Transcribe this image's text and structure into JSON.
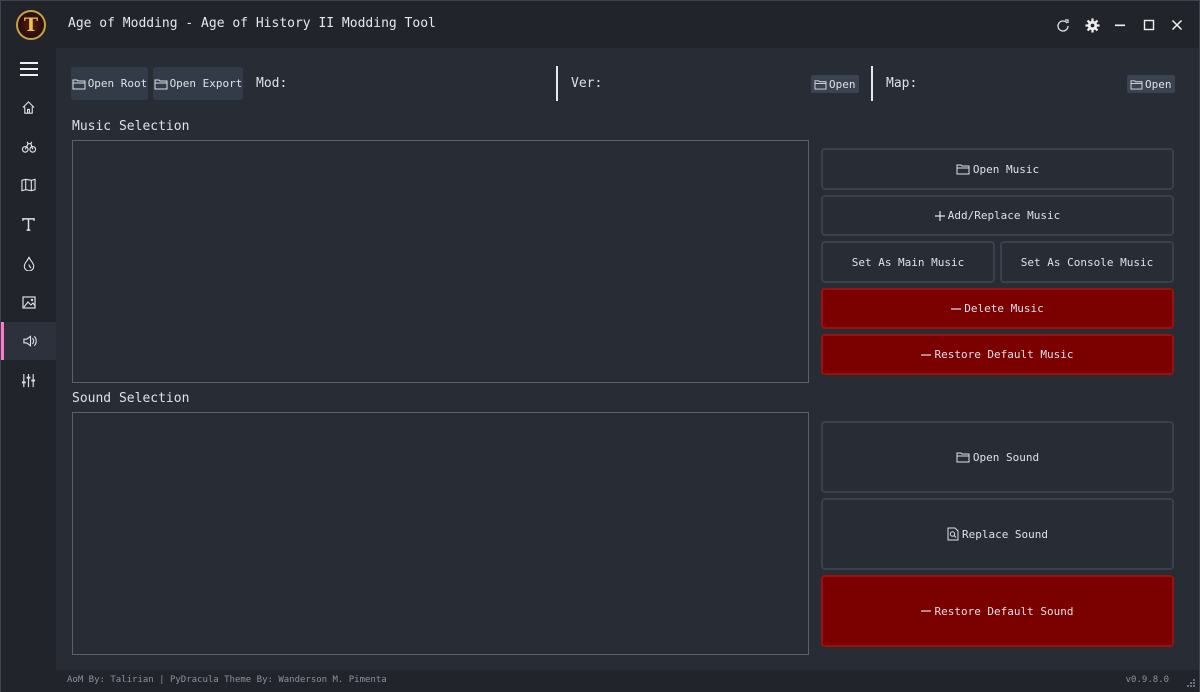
{
  "window": {
    "logo_letter": "T",
    "title": "Age of Modding - Age of History II Modding Tool"
  },
  "sidebar": {
    "items": [
      {
        "name": "menu-icon"
      },
      {
        "name": "home-icon"
      },
      {
        "name": "civilizations-icon"
      },
      {
        "name": "map-icon"
      },
      {
        "name": "text-icon"
      },
      {
        "name": "ideology-icon"
      },
      {
        "name": "image-icon"
      },
      {
        "name": "sound-icon",
        "active": true
      },
      {
        "name": "settings-sliders-icon"
      }
    ],
    "accent_color": "#ff79c6"
  },
  "toolbar": {
    "open_root_label": "Open Root",
    "open_export_label": "Open Export",
    "mod_label": "Mod:",
    "ver_label": "Ver:",
    "ver_open_label": "Open",
    "map_label": "Map:",
    "map_open_label": "Open"
  },
  "music": {
    "section_label": "Music Selection",
    "open_label": "Open Music",
    "add_replace_label": "Add/Replace Music",
    "set_main_label": "Set As Main Music",
    "set_console_label": "Set As Console Music",
    "delete_label": "Delete Music",
    "restore_label": "Restore Default Music"
  },
  "sound": {
    "section_label": "Sound Selection",
    "open_label": "Open Sound",
    "replace_label": "Replace Sound",
    "restore_label": "Restore Default Sound"
  },
  "footer": {
    "credits": "AoM By: Talirian | PyDracula Theme By: Wanderson M. Pimenta",
    "version": "v0.9.8.0"
  },
  "colors": {
    "danger": "#7b0000",
    "background": "#282c34",
    "bar": "#21252b"
  }
}
